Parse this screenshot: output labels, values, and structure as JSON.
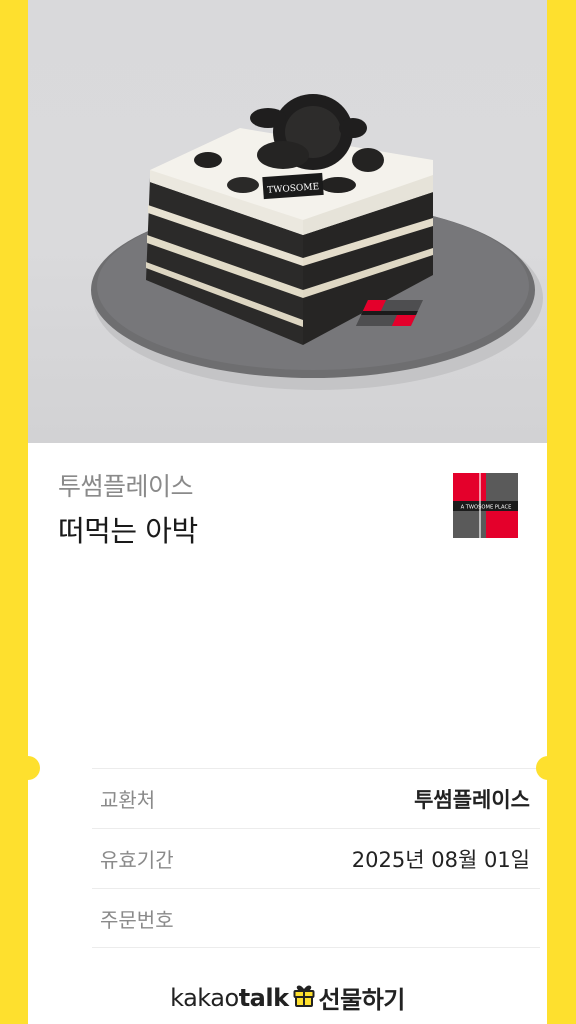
{
  "product": {
    "brand": "투썸플레이스",
    "name": "떠먹는 아박",
    "image_alt": "Oreo ice box cake slice on gray plate",
    "cake_tag": "TWOSOME",
    "logo_text": "A TWOSOME PLACE"
  },
  "details": {
    "exchange_label": "교환처",
    "exchange_value": "투썸플레이스",
    "expiry_label": "유효기간",
    "expiry_value": "2025년 08월 01일",
    "order_label": "주문번호",
    "order_value": ""
  },
  "footer": {
    "kakao_prefix": "kakao",
    "kakao_bold": "talk",
    "gift_label": "선물하기"
  },
  "colors": {
    "frame_yellow": "#FEE02E",
    "brand_red": "#E4002B",
    "brand_gray": "#5a5a5a"
  }
}
